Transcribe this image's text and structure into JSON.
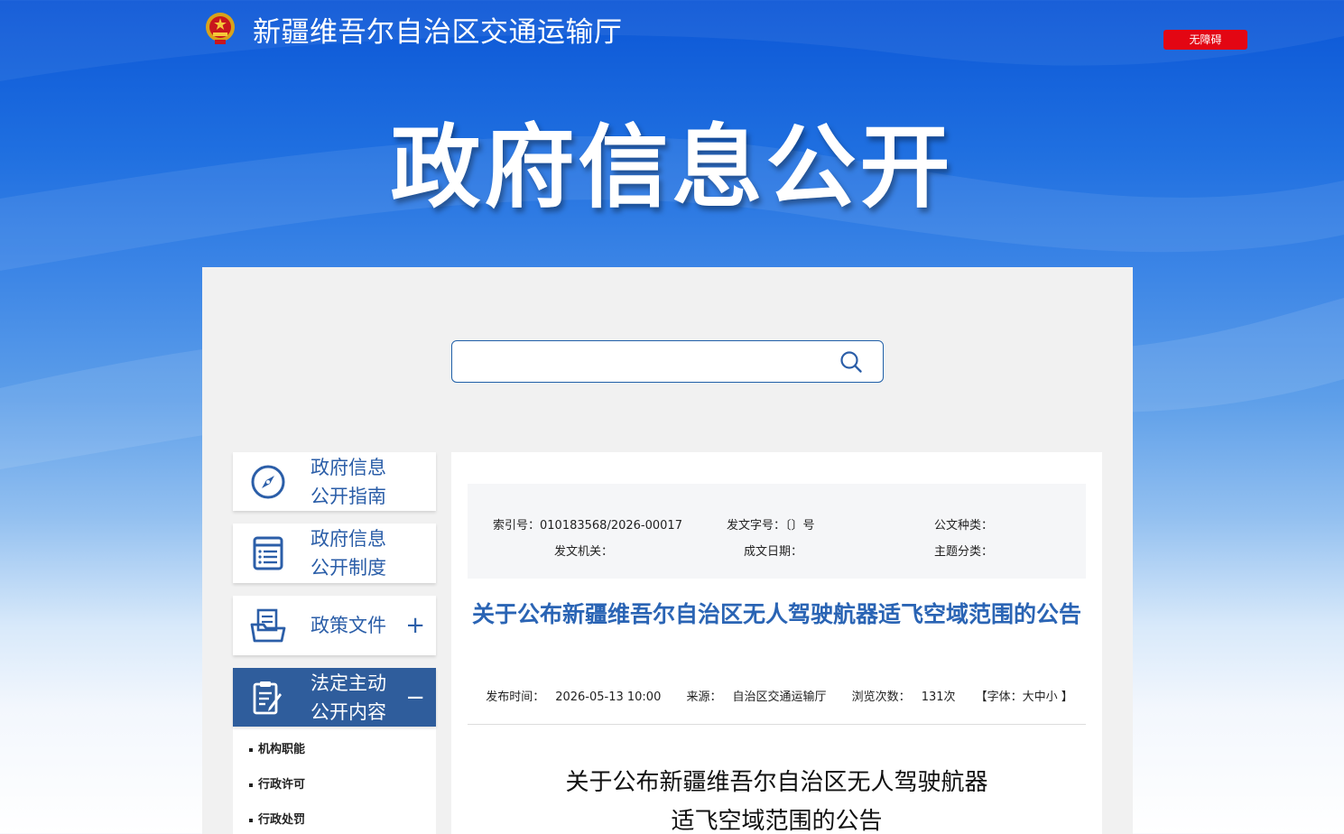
{
  "header": {
    "site_name": "新疆维吾尔自治区交通运输厅",
    "accessibility_label": "无障碍"
  },
  "hero": {
    "title": "政府信息公开"
  },
  "search": {
    "placeholder": "",
    "value": ""
  },
  "sidebar": {
    "items": [
      {
        "label": "政府信息公开指南",
        "icon": "compass-icon",
        "toggle": ""
      },
      {
        "label": "政府信息公开制度",
        "icon": "document-list-icon",
        "toggle": ""
      },
      {
        "label": "政策文件",
        "icon": "folder-document-icon",
        "toggle": "+"
      },
      {
        "label": "法定主动公开内容",
        "icon": "clipboard-edit-icon",
        "toggle": "−"
      }
    ],
    "subitems": [
      "机构职能",
      "行政许可",
      "行政处罚"
    ]
  },
  "meta": {
    "index_no_label": "索引号：",
    "index_no": "010183568/2026-00017",
    "doc_no_label": "发文字号：",
    "doc_no": "〔〕号",
    "doc_type_label": "公文种类：",
    "doc_type": "",
    "issuer_label": "发文机关：",
    "issuer": "",
    "date_label": "成文日期：",
    "date": "",
    "topic_label": "主题分类：",
    "topic": ""
  },
  "article": {
    "title": "关于公布新疆维吾尔自治区无人驾驶航器适飞空域范围的公告",
    "publish_label": "发布时间：",
    "publish_time": "2026-05-13 10:00",
    "source_label": "来源：",
    "source": "自治区交通运输厅",
    "views_label": "浏览次数：",
    "views": "131次",
    "font_label": "【字体：大中小 】",
    "body_title_line1": "关于公布新疆维吾尔自治区无人驾驶航器",
    "body_title_line2": "适飞空域范围的公告"
  },
  "colors": {
    "primary": "#2b5ea8",
    "active_nav": "#2f5d9c",
    "title_blue": "#2a64b4",
    "accessibility_red": "#e30613"
  }
}
